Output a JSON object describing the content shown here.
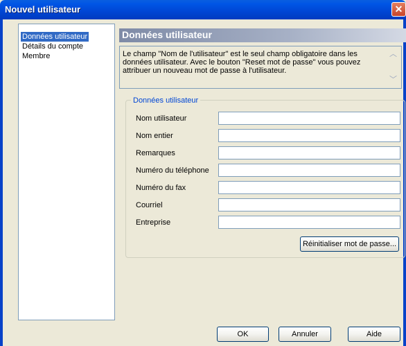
{
  "window": {
    "title": "Nouvel utilisateur",
    "close_glyph": "✕"
  },
  "nav": {
    "items": [
      "Données utilisateur",
      "Détails du compte",
      "Membre"
    ],
    "selected": 0
  },
  "section": {
    "title": "Données utilisateur",
    "description": "Le champ \"Nom de l'utilisateur\" est le seul champ obligatoire dans les données utilisateur. Avec le bouton \"Reset mot de passe\" vous pouvez attribuer un nouveau mot de passe à l'utilisateur."
  },
  "group": {
    "legend": "Données utilisateur",
    "fields": [
      {
        "label": "Nom utilisateur",
        "value": ""
      },
      {
        "label": "Nom entier",
        "value": ""
      },
      {
        "label": "Remarques",
        "value": ""
      },
      {
        "label": "Numéro du téléphone",
        "value": ""
      },
      {
        "label": "Numéro du fax",
        "value": ""
      },
      {
        "label": "Courriel",
        "value": ""
      },
      {
        "label": "Entreprise",
        "value": ""
      }
    ],
    "reset_button": "Réinitialiser mot de passe..."
  },
  "buttons": {
    "ok": "OK",
    "cancel": "Annuler",
    "help": "Aide"
  },
  "colors": {
    "titlebar": "#0055e5",
    "selection": "#316ac5",
    "legend": "#0046d5",
    "window_bg": "#ece9d8"
  }
}
